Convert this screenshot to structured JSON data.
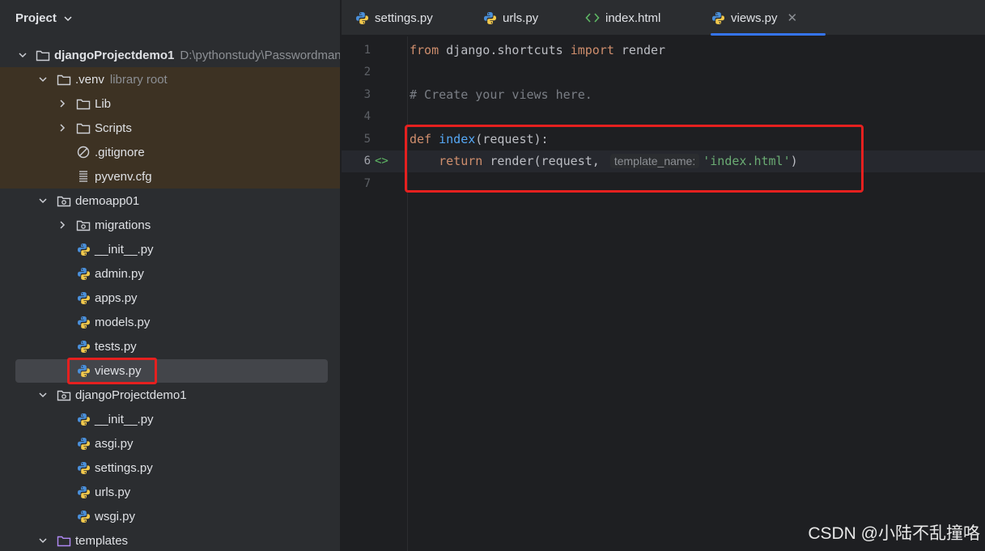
{
  "project_panel": {
    "title": "Project",
    "tree": [
      {
        "level": 0,
        "arrow": "down",
        "icon": "folder",
        "label": "djangoProjectdemo1",
        "hint": "D:\\pythonstudy\\Passwordmanager",
        "bold": true
      },
      {
        "level": 1,
        "arrow": "down",
        "icon": "folder",
        "label": ".venv",
        "hint": "library root",
        "excluded": true
      },
      {
        "level": 2,
        "arrow": "right",
        "icon": "folder",
        "label": "Lib",
        "excluded": true
      },
      {
        "level": 2,
        "arrow": "right",
        "icon": "folder",
        "label": "Scripts",
        "excluded": true
      },
      {
        "level": 2,
        "arrow": "none",
        "icon": "ignore",
        "label": ".gitignore",
        "excluded": true
      },
      {
        "level": 2,
        "arrow": "none",
        "icon": "config",
        "label": "pyvenv.cfg",
        "excluded": true
      },
      {
        "level": 1,
        "arrow": "down",
        "icon": "package",
        "label": "demoapp01"
      },
      {
        "level": 2,
        "arrow": "right",
        "icon": "package",
        "label": "migrations"
      },
      {
        "level": 2,
        "arrow": "none",
        "icon": "python",
        "label": "__init__.py"
      },
      {
        "level": 2,
        "arrow": "none",
        "icon": "python",
        "label": "admin.py"
      },
      {
        "level": 2,
        "arrow": "none",
        "icon": "python",
        "label": "apps.py"
      },
      {
        "level": 2,
        "arrow": "none",
        "icon": "python",
        "label": "models.py"
      },
      {
        "level": 2,
        "arrow": "none",
        "icon": "python",
        "label": "tests.py"
      },
      {
        "level": 2,
        "arrow": "none",
        "icon": "python",
        "label": "views.py",
        "selected": true
      },
      {
        "level": 1,
        "arrow": "down",
        "icon": "package",
        "label": "djangoProjectdemo1"
      },
      {
        "level": 2,
        "arrow": "none",
        "icon": "python",
        "label": "__init__.py"
      },
      {
        "level": 2,
        "arrow": "none",
        "icon": "python",
        "label": "asgi.py"
      },
      {
        "level": 2,
        "arrow": "none",
        "icon": "python",
        "label": "settings.py"
      },
      {
        "level": 2,
        "arrow": "none",
        "icon": "python",
        "label": "urls.py"
      },
      {
        "level": 2,
        "arrow": "none",
        "icon": "python",
        "label": "wsgi.py"
      },
      {
        "level": 1,
        "arrow": "down",
        "icon": "folder-purple",
        "label": "templates"
      }
    ]
  },
  "tabs": [
    {
      "label": "settings.py",
      "icon": "python"
    },
    {
      "label": "urls.py",
      "icon": "python"
    },
    {
      "label": "index.html",
      "icon": "html"
    },
    {
      "label": "views.py",
      "icon": "python",
      "active": true,
      "close": "✕"
    }
  ],
  "editor": {
    "current_line": 6,
    "lines": [
      {
        "n": "1",
        "tokens": [
          [
            "kw",
            "from"
          ],
          [
            "t",
            " django.shortcuts "
          ],
          [
            "kw",
            "import"
          ],
          [
            "t",
            " render"
          ]
        ]
      },
      {
        "n": "2",
        "tokens": []
      },
      {
        "n": "3",
        "tokens": [
          [
            "cm",
            "# Create your views here."
          ]
        ]
      },
      {
        "n": "4",
        "tokens": []
      },
      {
        "n": "5",
        "tokens": [
          [
            "kw",
            "def"
          ],
          [
            "t",
            " "
          ],
          [
            "fn",
            "index"
          ],
          [
            "t",
            "(request):"
          ]
        ]
      },
      {
        "n": "6",
        "gutter": "<>",
        "tokens": [
          [
            "t",
            "    "
          ],
          [
            "kw",
            "return"
          ],
          [
            "t",
            " render(request, "
          ],
          [
            "hint",
            "template_name:"
          ],
          [
            "str",
            "'index.html'"
          ],
          [
            "t",
            ")"
          ]
        ]
      },
      {
        "n": "7",
        "tokens": []
      }
    ]
  },
  "watermark": "CSDN @小陆不乱撞咯",
  "colors": {
    "accent": "#3574f0",
    "highlight_box": "#e5201f"
  }
}
